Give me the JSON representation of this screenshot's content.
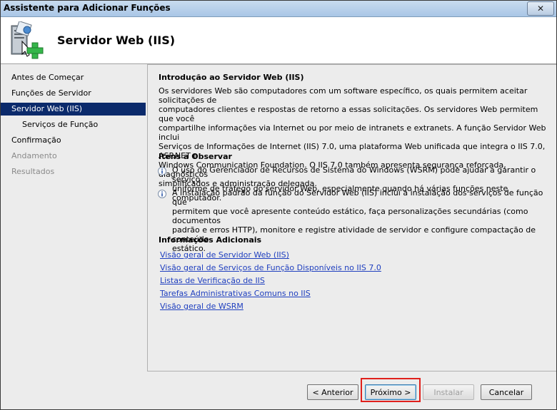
{
  "window": {
    "title": "Assistente para Adicionar Funções",
    "close_label": "✕"
  },
  "header": {
    "title": "Servidor Web (IIS)",
    "icon": "server-role-icon"
  },
  "nav": {
    "items": [
      {
        "label": "Antes de Começar",
        "state": "normal"
      },
      {
        "label": "Funções de Servidor",
        "state": "normal"
      },
      {
        "label": "Servidor Web (IIS)",
        "state": "selected"
      },
      {
        "label": "Serviços de Função",
        "state": "normal"
      },
      {
        "label": "Confirmação",
        "state": "normal"
      },
      {
        "label": "Andamento",
        "state": "disabled"
      },
      {
        "label": "Resultados",
        "state": "disabled"
      }
    ]
  },
  "content": {
    "intro_heading": "Introdução ao Servidor Web (IIS)",
    "intro_lines": [
      "Os servidores Web são computadores com um software específico, os quais permitem aceitar solicitações de",
      "computadores clientes e respostas de retorno a essas solicitações. Os servidores Web permitem que você",
      "compartilhe informações via Internet ou por meio de intranets e extranets. A função Servidor Web inclui",
      "Serviços de Informações de Internet (IIS) 7.0, uma plataforma Web unificada que integra o IIS 7.0, ASP.NET e",
      "Windows Communication Foundation. O IIS 7.0 também apresenta segurança reforçada, diagnósticos",
      "simplificados e administração delegada."
    ],
    "notes_heading": "Itens a Observar",
    "notes": [
      {
        "lines": [
          "O uso do Gerenciador de Recursos de Sistema do Windows (WSRM) pode ajudar a garantir o serviço",
          "uniforme de tráfego do servidor Web, especialmente quando há várias funções neste computador."
        ]
      },
      {
        "lines": [
          "A instalação padrão da função do Servidor Web (IIS) inclui a instalação dos serviços de função que",
          "permitem que você apresente conteúdo estático, faça personalizações secundárias (como documentos",
          "padrão e erros HTTP), monitore e registre atividade de servidor e configure compactação de conteúdo",
          "estático."
        ]
      }
    ],
    "more_heading": "Informações Adicionais",
    "links": [
      "Visão geral de Servidor Web (IIS)",
      "Visão geral de Serviços de Função Disponíveis no IIS 7.0",
      "Listas de Verificação de IIS",
      "Tarefas Administrativas Comuns no IIS",
      "Visão geral de WSRM"
    ]
  },
  "buttons": {
    "back": "< Anterior",
    "next": "Próximo >",
    "install": "Instalar",
    "cancel": "Cancelar"
  },
  "colors": {
    "nav_selected_bg": "#0b2a6b",
    "link": "#1f3fbf",
    "highlight_box": "#e0201c"
  }
}
